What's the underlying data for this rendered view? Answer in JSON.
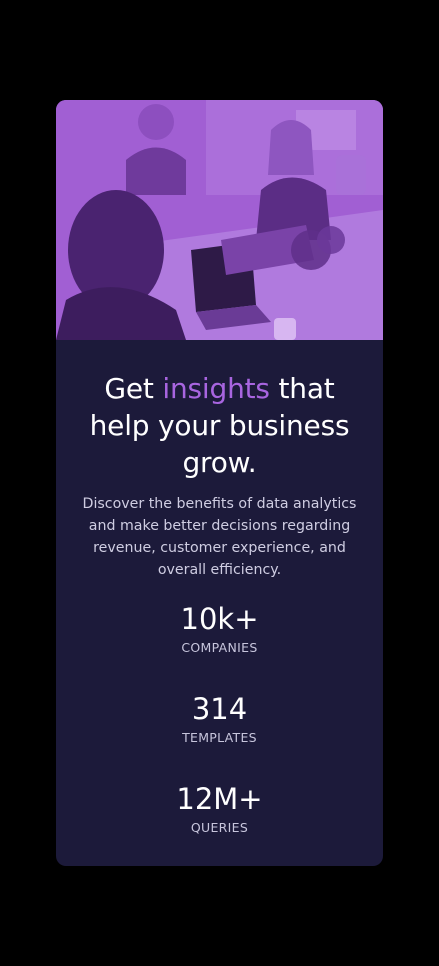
{
  "card": {
    "image_alt": "People working together at a table with laptops",
    "overlay_color": "#aa5cdb"
  },
  "headline": {
    "before": "Get ",
    "accent": "insights",
    "after": " that help your business grow."
  },
  "description": "Discover the benefits of data analytics and make better decisions regarding revenue, customer experience, and overall efficiency.",
  "stats": [
    {
      "value": "10k+",
      "label": "COMPANIES"
    },
    {
      "value": "314",
      "label": "TEMPLATES"
    },
    {
      "value": "12M+",
      "label": "QUERIES"
    }
  ],
  "colors": {
    "background": "#000000",
    "card": "#1c1a3a",
    "accent": "#a865e0",
    "text": "#ffffff",
    "muted": "#cfcde2"
  }
}
